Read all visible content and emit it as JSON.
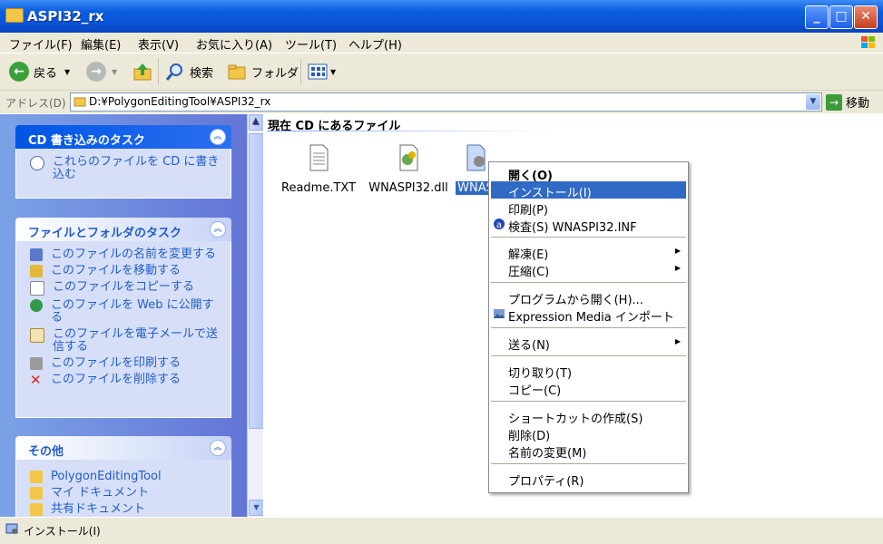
{
  "window": {
    "title": "ASPI32_rx"
  },
  "menubar": {
    "items": [
      "ファイル(F)",
      "編集(E)",
      "表示(V)",
      "お気に入り(A)",
      "ツール(T)",
      "ヘルプ(H)"
    ]
  },
  "toolbar": {
    "back_label": "戻る",
    "search_label": "検索",
    "folders_label": "フォルダ"
  },
  "address": {
    "label": "アドレス(D)",
    "value": "D:¥PolygonEditingTool¥ASPI32_rx",
    "go_label": "移動"
  },
  "left_pane": {
    "cd_panel": {
      "title": "CD 書き込みのタスク",
      "tasks": [
        "これらのファイルを CD に書き込む"
      ]
    },
    "file_panel": {
      "title": "ファイルとフォルダのタスク",
      "tasks": [
        "このファイルの名前を変更する",
        "このファイルを移動する",
        "このファイルをコピーする",
        "このファイルを Web に公開する",
        "このファイルを電子メールで送信する",
        "このファイルを印刷する",
        "このファイルを削除する"
      ]
    },
    "other_panel": {
      "title": "その他",
      "items": [
        "PolygonEditingTool",
        "マイ ドキュメント",
        "共有ドキュメント"
      ]
    }
  },
  "content": {
    "group_header": "現在 CD にあるファイル",
    "files": [
      {
        "name": "Readme.TXT"
      },
      {
        "name": "WNASPI32.dll"
      },
      {
        "name": "WNAS"
      }
    ]
  },
  "context_menu": {
    "items": [
      {
        "label": "開く(O)"
      },
      {
        "label": "インストール(I)"
      },
      {
        "label": "印刷(P)"
      },
      {
        "label": "検査(S) WNASPI32.INF"
      },
      {
        "label": "解凍(E)"
      },
      {
        "label": "圧縮(C)"
      },
      {
        "label": "プログラムから開く(H)..."
      },
      {
        "label": "Expression Media インポート"
      },
      {
        "label": "送る(N)"
      },
      {
        "label": "切り取り(T)"
      },
      {
        "label": "コピー(C)"
      },
      {
        "label": "ショートカットの作成(S)"
      },
      {
        "label": "削除(D)"
      },
      {
        "label": "名前の変更(M)"
      },
      {
        "label": "プロパティ(R)"
      }
    ]
  },
  "status": {
    "text": "インストール(I)"
  },
  "colors": {
    "title_blue": "#0a54d8",
    "task_blue": "#215dc6",
    "highlight": "#316ac5",
    "pane_blue": "#7ba2e7"
  }
}
